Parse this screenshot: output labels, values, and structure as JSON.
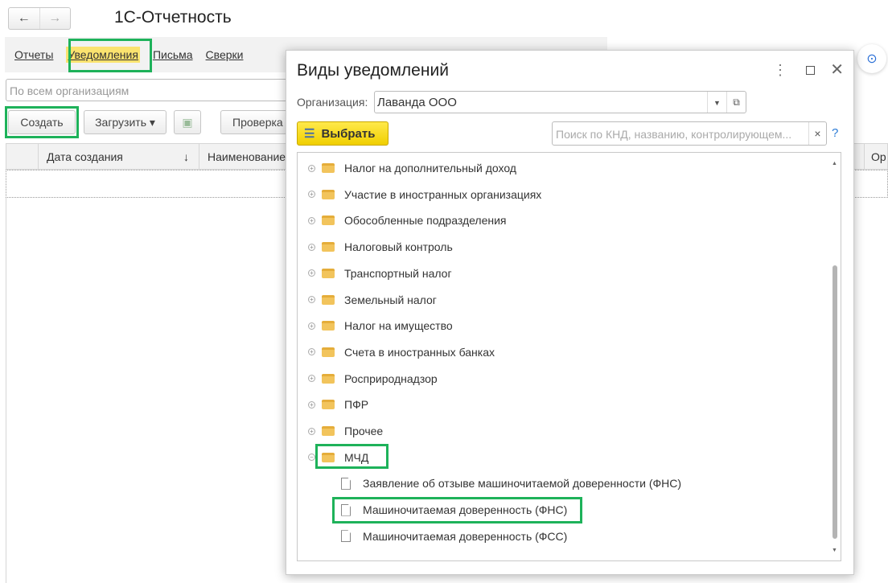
{
  "window": {
    "title": "1С-Отчетность",
    "back": "←",
    "forward": "→"
  },
  "tabs": [
    {
      "label": "Отчеты"
    },
    {
      "label": "Уведомления",
      "active": true
    },
    {
      "label": "Письма"
    },
    {
      "label": "Сверки"
    }
  ],
  "filter": {
    "placeholder": "По всем организациям"
  },
  "toolbar": {
    "create": "Создать",
    "load": "Загрузить ▾",
    "check": "Проверка"
  },
  "table": {
    "columns": [
      "Дата создания",
      "Наименование",
      "Ор"
    ],
    "sort_icon": "↓"
  },
  "dialog": {
    "title": "Виды уведомлений",
    "org_label": "Организация:",
    "org_value": "Лаванда ООО",
    "select_button": "Выбрать",
    "search_placeholder": "Поиск по КНД, названию, контролирующем...",
    "search_clear": "×",
    "help": "?",
    "tree": [
      {
        "label": "Налог на дополнительный доход",
        "type": "folder"
      },
      {
        "label": "Участие в иностранных организациях",
        "type": "folder"
      },
      {
        "label": "Обособленные подразделения",
        "type": "folder"
      },
      {
        "label": "Налоговый контроль",
        "type": "folder"
      },
      {
        "label": "Транспортный налог",
        "type": "folder"
      },
      {
        "label": "Земельный налог",
        "type": "folder"
      },
      {
        "label": "Налог на имущество",
        "type": "folder"
      },
      {
        "label": "Счета в иностранных банках",
        "type": "folder"
      },
      {
        "label": "Росприроднадзор",
        "type": "folder"
      },
      {
        "label": "ПФР",
        "type": "folder"
      },
      {
        "label": "Прочее",
        "type": "folder"
      },
      {
        "label": "МЧД",
        "type": "folder",
        "expanded": true
      },
      {
        "label": "Заявление об отзыве машиночитаемой доверенности (ФНС)",
        "type": "doc"
      },
      {
        "label": "Машиночитаемая доверенность (ФНС)",
        "type": "doc"
      },
      {
        "label": "Машиночитаемая доверенность (ФСС)",
        "type": "doc"
      }
    ]
  },
  "colors": {
    "highlight": "#1eb25a",
    "active_tab": "#fbe36f",
    "primary_button": "#f5d800"
  }
}
